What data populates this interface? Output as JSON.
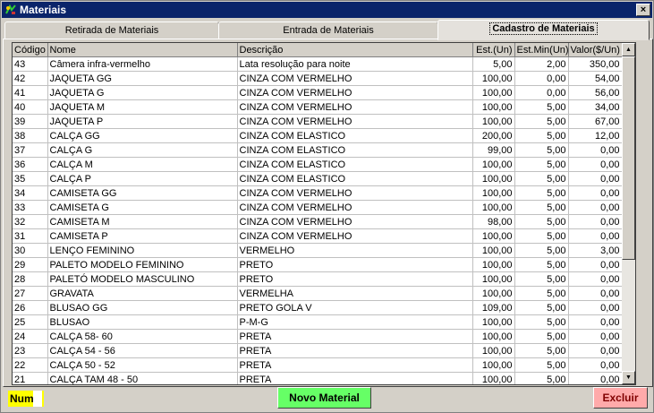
{
  "window": {
    "title": "Materiais",
    "close_label": "×"
  },
  "tabs": [
    {
      "label": "Retirada de Materiais"
    },
    {
      "label": "Entrada de Materiais"
    },
    {
      "label": "Cadastro de Materiais"
    }
  ],
  "grid": {
    "columns": [
      "Código",
      "Nome",
      "Descrição",
      "Est.(Un)",
      "Est.Min(Un)",
      "Valor($/Un)"
    ],
    "rows": [
      [
        "43",
        "Câmera infra-vermelho",
        "Lata resolução para noite",
        "5,00",
        "2,00",
        "350,00"
      ],
      [
        "42",
        "JAQUETA GG",
        "CINZA COM VERMELHO",
        "100,00",
        "0,00",
        "54,00"
      ],
      [
        "41",
        "JAQUETA G",
        "CINZA COM VERMELHO",
        "100,00",
        "0,00",
        "56,00"
      ],
      [
        "40",
        "JAQUETA M",
        "CINZA COM VERMELHO",
        "100,00",
        "5,00",
        "34,00"
      ],
      [
        "39",
        "JAQUETA P",
        "CINZA COM VERMELHO",
        "100,00",
        "5,00",
        "67,00"
      ],
      [
        "38",
        "CALÇA GG",
        "CINZA COM ELASTICO",
        "200,00",
        "5,00",
        "12,00"
      ],
      [
        "37",
        "CALÇA G",
        "CINZA COM ELASTICO",
        "99,00",
        "5,00",
        "0,00"
      ],
      [
        "36",
        "CALÇA M",
        "CINZA COM ELASTICO",
        "100,00",
        "5,00",
        "0,00"
      ],
      [
        "35",
        "CALÇA P",
        "CINZA COM ELASTICO",
        "100,00",
        "5,00",
        "0,00"
      ],
      [
        "34",
        "CAMISETA GG",
        "CINZA COM VERMELHO",
        "100,00",
        "5,00",
        "0,00"
      ],
      [
        "33",
        "CAMISETA G",
        "CINZA COM VERMELHO",
        "100,00",
        "5,00",
        "0,00"
      ],
      [
        "32",
        "CAMISETA M",
        "CINZA COM VERMELHO",
        "98,00",
        "5,00",
        "0,00"
      ],
      [
        "31",
        "CAMISETA  P",
        "CINZA COM VERMELHO",
        "100,00",
        "5,00",
        "0,00"
      ],
      [
        "30",
        "LENÇO FEMININO",
        "VERMELHO",
        "100,00",
        "5,00",
        "3,00"
      ],
      [
        "29",
        "PALETO MODELO FEMININO",
        "PRETO",
        "100,00",
        "5,00",
        "0,00"
      ],
      [
        "28",
        "PALETÓ  MODELO MASCULINO",
        "PRETO",
        "100,00",
        "5,00",
        "0,00"
      ],
      [
        "27",
        "GRAVATA",
        "VERMELHA",
        "100,00",
        "5,00",
        "0,00"
      ],
      [
        "26",
        "BLUSAO  GG",
        "PRETO GOLA V",
        "109,00",
        "5,00",
        "0,00"
      ],
      [
        "25",
        "BLUSAO",
        "P-M-G",
        "100,00",
        "5,00",
        "0,00"
      ],
      [
        "24",
        "CALÇA 58- 60",
        "PRETA",
        "100,00",
        "5,00",
        "0,00"
      ],
      [
        "23",
        "CALÇA 54 - 56",
        "PRETA",
        "100,00",
        "5,00",
        "0,00"
      ],
      [
        "22",
        "CALÇA 50 - 52",
        "PRETA",
        "100,00",
        "5,00",
        "0,00"
      ],
      [
        "21",
        "CALÇA TAM 48 - 50",
        "PRETA",
        "100,00",
        "5,00",
        "0,00"
      ]
    ]
  },
  "footer": {
    "num_label": "Num",
    "novo_label": "Novo Material",
    "excluir_label": "Excluir"
  },
  "colors": {
    "titlebar": "#0a246a",
    "num_label_bg": "#ffff00",
    "novo_button_bg": "#66ff66",
    "excluir_button_bg": "#ffaaaa",
    "excluir_text": "#800000"
  }
}
